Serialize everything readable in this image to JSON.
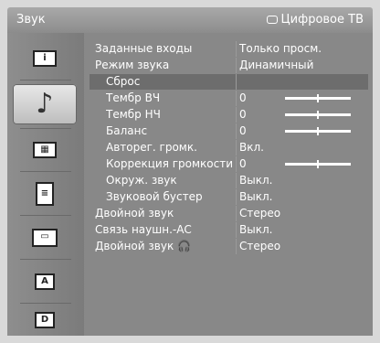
{
  "window": {
    "title": "Звук",
    "source_label": "Цифровое ТВ"
  },
  "sidebar": {
    "items": [
      {
        "name": "picture-info-icon",
        "glyph": "i"
      },
      {
        "name": "sound-note-icon",
        "glyph": "♪"
      },
      {
        "name": "screen-settings-icon",
        "glyph": "▦"
      },
      {
        "name": "list-settings-icon",
        "glyph": "≡"
      },
      {
        "name": "display-icon",
        "glyph": "▭"
      },
      {
        "name": "analog-channels-icon",
        "glyph": "A"
      },
      {
        "name": "digital-channels-icon",
        "glyph": "D"
      }
    ]
  },
  "menu": {
    "rows": [
      {
        "label": "Заданные входы",
        "value": "Только просм.",
        "indent": false,
        "slider": false,
        "highlight": false
      },
      {
        "label": "Режим звука",
        "value": "Динамичный",
        "indent": false,
        "slider": false,
        "highlight": false
      },
      {
        "label": "Сброс",
        "value": "",
        "indent": true,
        "slider": false,
        "highlight": true
      },
      {
        "label": "Тембр ВЧ",
        "value": "0",
        "indent": true,
        "slider": true,
        "slider_level": 0.5,
        "highlight": false
      },
      {
        "label": "Тембр НЧ",
        "value": "0",
        "indent": true,
        "slider": true,
        "slider_level": 0.5,
        "highlight": false
      },
      {
        "label": "Баланс",
        "value": "0",
        "indent": true,
        "slider": true,
        "slider_level": 0.5,
        "highlight": false
      },
      {
        "label": "Авторег. громк.",
        "value": "Вкл.",
        "indent": true,
        "slider": false,
        "highlight": false
      },
      {
        "label": "Коррекция громкости",
        "value": "0",
        "indent": true,
        "slider": true,
        "slider_level": 0.5,
        "highlight": false
      },
      {
        "label": "Окруж. звук",
        "value": "Выкл.",
        "indent": true,
        "slider": false,
        "highlight": false
      },
      {
        "label": "Звуковой бустер",
        "value": "Выкл.",
        "indent": true,
        "slider": false,
        "highlight": false
      },
      {
        "label": "Двойной звук",
        "value": "Стерео",
        "indent": false,
        "slider": false,
        "highlight": false
      },
      {
        "label": "Связь наушн.-АС",
        "value": "Выкл.",
        "indent": false,
        "slider": false,
        "highlight": false
      },
      {
        "label": "Двойной звук 🎧",
        "value": "Стерео",
        "indent": false,
        "slider": false,
        "highlight": false
      }
    ]
  }
}
